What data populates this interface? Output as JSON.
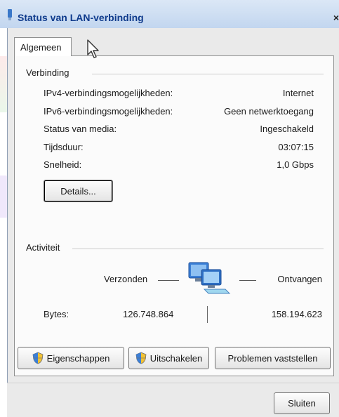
{
  "window": {
    "title": "Status van LAN-verbinding",
    "close_label": "×"
  },
  "tabs": [
    {
      "label": "Algemeen",
      "selected": true
    }
  ],
  "connection": {
    "group_label": "Verbinding",
    "rows": [
      {
        "label": "IPv4-verbindingsmogelijkheden:",
        "value": "Internet"
      },
      {
        "label": "IPv6-verbindingsmogelijkheden:",
        "value": "Geen netwerktoegang"
      },
      {
        "label": "Status van media:",
        "value": "Ingeschakeld"
      },
      {
        "label": "Tijdsduur:",
        "value": "03:07:15"
      },
      {
        "label": "Snelheid:",
        "value": "1,0 Gbps"
      }
    ],
    "details_button": "Details..."
  },
  "activity": {
    "group_label": "Activiteit",
    "sent_label": "Verzonden",
    "received_label": "Ontvangen",
    "bytes_label": "Bytes:",
    "bytes_sent": "126.748.864",
    "bytes_received": "158.194.623",
    "network_icon": "network-computers-icon"
  },
  "actions": {
    "properties_button": "Eigenschappen",
    "disable_button": "Uitschakelen",
    "diagnose_button": "Problemen vaststellen",
    "close_button": "Sluiten"
  },
  "colors": {
    "title_text": "#0f3b8c",
    "titlebar": "#c2d6ef",
    "dialog_bg": "#eaeaea",
    "panel_bg": "#fbfbfb"
  }
}
